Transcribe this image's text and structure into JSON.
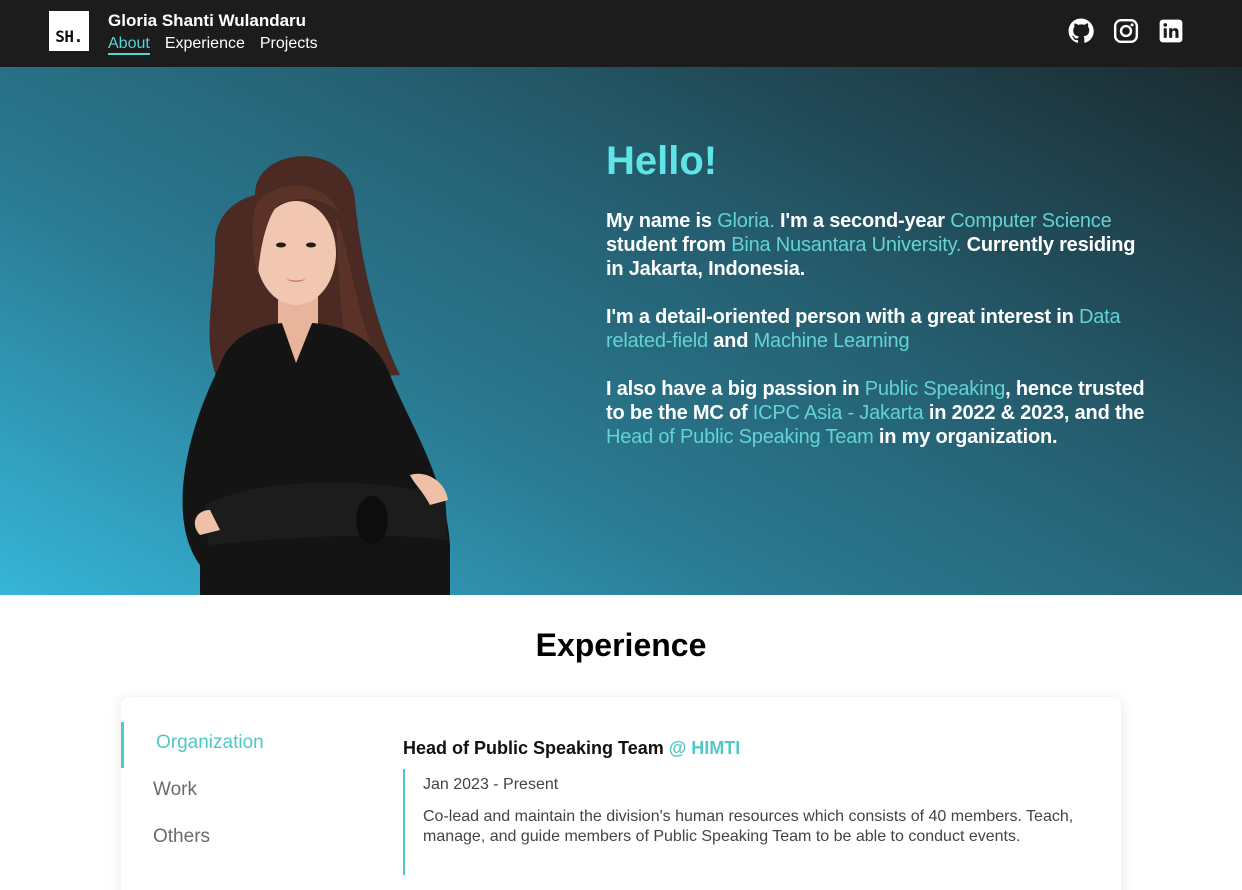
{
  "navbar": {
    "logo_text": "SH.",
    "brand_name": "Gloria Shanti Wulandaru",
    "links": [
      {
        "label": "About",
        "active": true
      },
      {
        "label": "Experience",
        "active": false
      },
      {
        "label": "Projects",
        "active": false
      }
    ],
    "socials": [
      "github-icon",
      "instagram-icon",
      "linkedin-icon"
    ]
  },
  "hero": {
    "greeting": "Hello!",
    "para1": {
      "t1": "My name is ",
      "h1": "Gloria.",
      "t2": " I'm a second-year ",
      "h2": "Computer Science",
      "t3": " student from ",
      "h3": "Bina Nusantara University.",
      "t4": " Currently residing in Jakarta, Indonesia."
    },
    "para2": {
      "t1": "I'm a detail-oriented person with a great interest in ",
      "h1": "Data related-field",
      "t2": " and ",
      "h2": "Machine Learning"
    },
    "para3": {
      "t1": "I also have a big passion in ",
      "h1": "Public Speaking",
      "t2": ", hence trusted to be the MC of ",
      "h2": "ICPC Asia - Jakarta",
      "t3": " in 2022 & 2023, and the ",
      "h3": "Head of Public Speaking Team",
      "t4": " in my organization."
    }
  },
  "experience": {
    "title": "Experience",
    "tabs": [
      {
        "label": "Organization",
        "active": true
      },
      {
        "label": "Work",
        "active": false
      },
      {
        "label": "Others",
        "active": false
      }
    ],
    "entry": {
      "role": "Head of Public Speaking Team",
      "org": "@ HIMTI",
      "date": "Jan 2023 - Present",
      "description": "Co-lead and maintain the division's human resources which consists of 40 members. Teach, manage, and guide members of Public Speaking Team to be able to conduct events."
    }
  },
  "colors": {
    "accent": "#52c7c7",
    "greeting": "#5ee6e6",
    "navbar_bg": "#1c1c1c"
  }
}
